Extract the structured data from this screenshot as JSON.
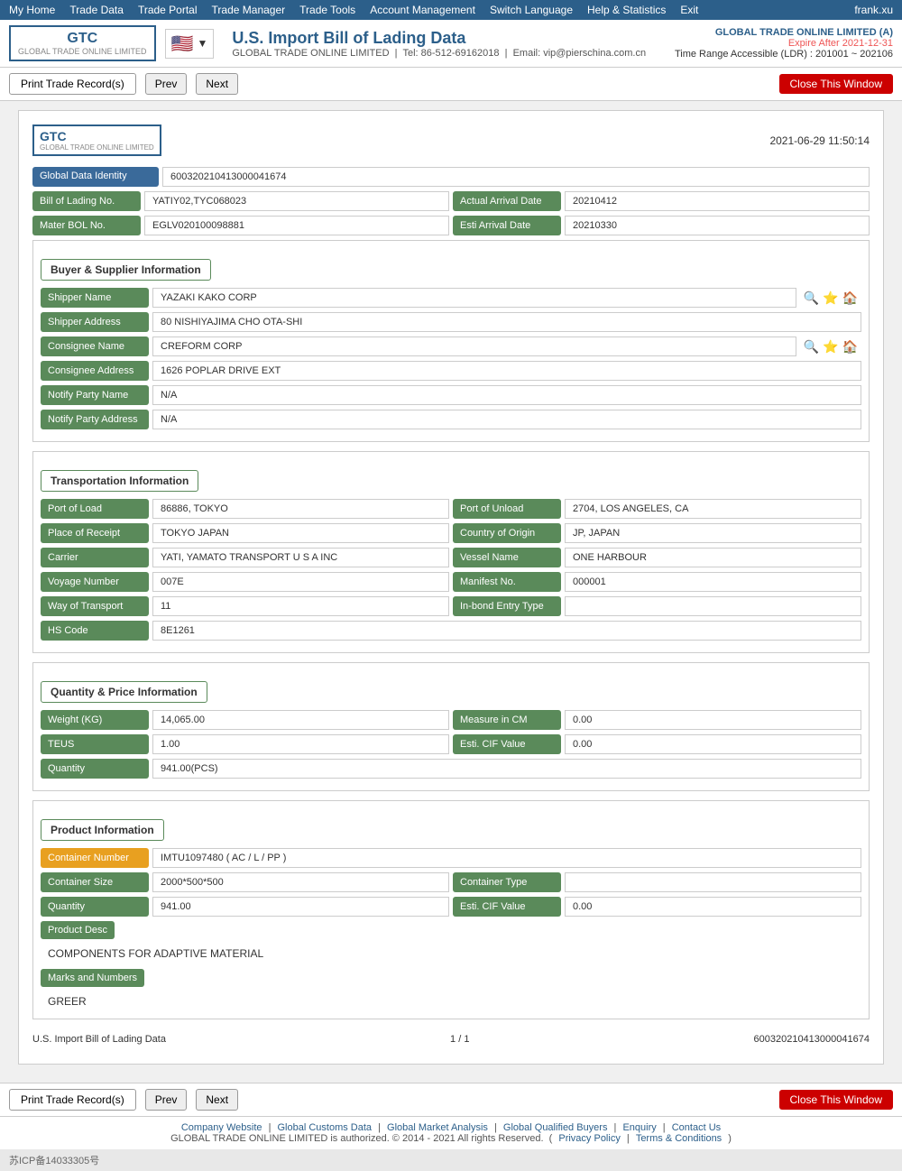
{
  "nav": {
    "items": [
      "My Home",
      "Trade Data",
      "Trade Portal",
      "Trade Manager",
      "Trade Tools",
      "Account Management",
      "Switch Language",
      "Help & Statistics",
      "Exit"
    ],
    "user": "frank.xu"
  },
  "header": {
    "logo_top": "GTC",
    "logo_bottom": "GLOBAL TRADE ONLINE LIMITED",
    "flag_emoji": "🇺🇸",
    "title": "U.S. Import Bill of Lading Data",
    "subtitle_company": "GLOBAL TRADE ONLINE LIMITED",
    "subtitle_tel": "Tel: 86-512-69162018",
    "subtitle_email": "Email: vip@pierschina.com.cn",
    "account_company": "GLOBAL TRADE ONLINE LIMITED (A)",
    "expire_label": "Expire After 2021-12-31",
    "ldr_label": "Time Range Accessible (LDR) : 201001 ~ 202106"
  },
  "toolbar": {
    "print_label": "Print Trade Record(s)",
    "prev_label": "Prev",
    "next_label": "Next",
    "close_label": "Close This Window"
  },
  "record": {
    "timestamp": "2021-06-29 11:50:14",
    "logo_text": "GTC",
    "logo_sub": "GLOBAL TRADE ONLINE LIMITED",
    "global_data_identity": "600320210413000041674",
    "bill_of_lading_no": "YATIY02,TYC068023",
    "actual_arrival_date": "20210412",
    "mater_bol_no": "EGLV020100098881",
    "esti_arrival_date": "20210330",
    "buyer_supplier": {
      "shipper_name": "YAZAKI KAKO CORP",
      "shipper_address": "80 NISHIYAJIMA CHO OTA-SHI",
      "consignee_name": "CREFORM CORP",
      "consignee_address": "1626 POPLAR DRIVE EXT",
      "notify_party_name": "N/A",
      "notify_party_address": "N/A"
    },
    "transportation": {
      "port_of_load": "86886, TOKYO",
      "port_of_unload": "2704, LOS ANGELES, CA",
      "place_of_receipt": "TOKYO JAPAN",
      "country_of_origin": "JP, JAPAN",
      "carrier": "YATI, YAMATO TRANSPORT U S A INC",
      "vessel_name": "ONE HARBOUR",
      "voyage_number": "007E",
      "manifest_no": "000001",
      "way_of_transport": "11",
      "inbond_entry_type": "",
      "hs_code": "8E1261"
    },
    "quantity_price": {
      "weight_kg": "14,065.00",
      "measure_in_cm": "0.00",
      "teus": "1.00",
      "esti_cif_value_1": "0.00",
      "quantity": "941.00(PCS)"
    },
    "product": {
      "container_number": "IMTU1097480 ( AC / L / PP )",
      "container_size": "2000*500*500",
      "container_type": "",
      "quantity": "941.00",
      "esti_cif_value": "0.00",
      "product_desc": "COMPONENTS FOR ADAPTIVE MATERIAL",
      "marks_numbers": "GREER"
    },
    "footer_title": "U.S. Import Bill of Lading Data",
    "footer_page": "1 / 1",
    "footer_id": "600320210413000041674"
  },
  "labels": {
    "global_data_identity": "Global Data Identity",
    "bill_of_lading_no": "Bill of Lading No.",
    "actual_arrival_date": "Actual Arrival Date",
    "mater_bol_no": "Mater BOL No.",
    "esti_arrival_date": "Esti Arrival Date",
    "buyer_supplier_section": "Buyer & Supplier Information",
    "shipper_name": "Shipper Name",
    "shipper_address": "Shipper Address",
    "consignee_name": "Consignee Name",
    "consignee_address": "Consignee Address",
    "notify_party_name": "Notify Party Name",
    "notify_party_address": "Notify Party Address",
    "transportation_section": "Transportation Information",
    "port_of_load": "Port of Load",
    "port_of_unload": "Port of Unload",
    "place_of_receipt": "Place of Receipt",
    "country_of_origin": "Country of Origin",
    "carrier": "Carrier",
    "vessel_name": "Vessel Name",
    "voyage_number": "Voyage Number",
    "manifest_no": "Manifest No.",
    "way_of_transport": "Way of Transport",
    "inbond_entry_type": "In-bond Entry Type",
    "hs_code": "HS Code",
    "quantity_price_section": "Quantity & Price Information",
    "weight_kg": "Weight (KG)",
    "measure_in_cm": "Measure in CM",
    "teus": "TEUS",
    "esti_cif_value": "Esti. CIF Value",
    "quantity": "Quantity",
    "product_section": "Product Information",
    "container_number": "Container Number",
    "container_size": "Container Size",
    "container_type": "Container Type",
    "product_quantity": "Quantity",
    "product_esti_cif": "Esti. CIF Value",
    "product_desc": "Product Desc",
    "marks_numbers": "Marks and Numbers"
  },
  "footer_links": {
    "company_website": "Company Website",
    "global_customs_data": "Global Customs Data",
    "global_market_analysis": "Global Market Analysis",
    "global_qualified_buyers": "Global Qualified Buyers",
    "enquiry": "Enquiry",
    "contact_us": "Contact Us",
    "copyright": "GLOBAL TRADE ONLINE LIMITED is authorized. © 2014 - 2021 All rights Reserved.",
    "privacy_policy": "Privacy Policy",
    "terms": "Terms & Conditions",
    "icp": "苏ICP备14033305号"
  }
}
